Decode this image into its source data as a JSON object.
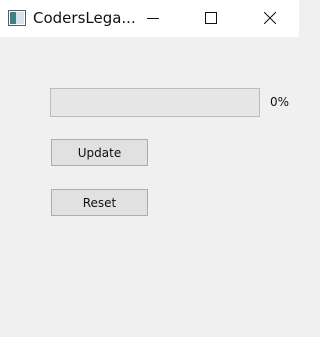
{
  "window": {
    "title": "CodersLega...",
    "controls": {
      "minimize_icon": "minimize-icon",
      "maximize_icon": "maximize-icon",
      "close_icon": "close-icon"
    }
  },
  "progress": {
    "value": 0,
    "text": "0%",
    "fill_color": "#06b025"
  },
  "buttons": {
    "update_label": "Update",
    "reset_label": "Reset"
  }
}
